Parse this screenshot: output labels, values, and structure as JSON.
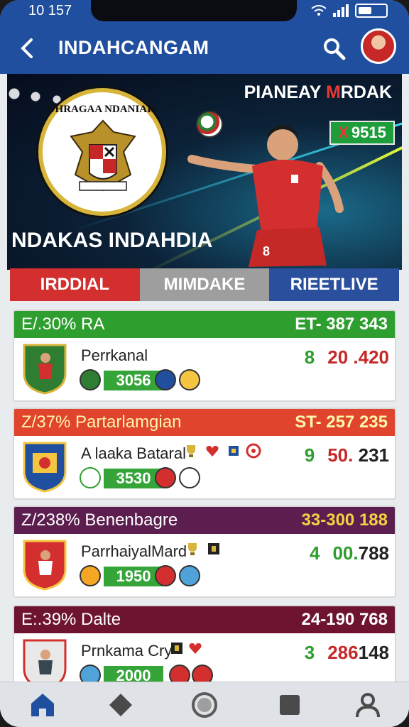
{
  "status_bar": {
    "time": "10 157"
  },
  "app_bar": {
    "title": "INDAHCANGAM"
  },
  "hero": {
    "headline_main": "PIANEAY ",
    "headline_accent": "M",
    "headline_tail": "RDAK",
    "crest_text": "UHRAGAA NDANIAIS",
    "score_badge_x": "X",
    "score_badge_value": "9515",
    "team_name": "NDAKAS INDAHDIA"
  },
  "tabs": [
    {
      "label": "IRDDIAL"
    },
    {
      "label": "MIMDAKE"
    },
    {
      "label": "RIEETLIVE"
    }
  ],
  "cards": [
    {
      "header_left": "E/.30% RA",
      "header_right": "ET- 387 343",
      "header_color": "#2e9e2e",
      "header_text_color": "#ffffff",
      "team": "Perrkanal",
      "pill": "3056",
      "score_green": "8",
      "score_red": "20",
      "score_dark": ".420"
    },
    {
      "header_left": "Z/37% Partarlamgian",
      "header_right": "ST- 257 235",
      "header_color": "#e0442c",
      "header_text_color": "#fff7a8",
      "team": "A laaka Bataral",
      "pill": "3530",
      "score_green": "9",
      "score_red": "50.",
      "score_dark": "231"
    },
    {
      "header_left": "Z/238% Benenbagre",
      "header_right": "33-300 188",
      "header_color": "#5b1e4e",
      "header_text_color": "#ffffff",
      "team": "ParrhaiyalMard",
      "pill": "1950",
      "score_green": "4",
      "score_red": "00.",
      "score_dark": "788"
    },
    {
      "header_left": "E:.39% Dalte",
      "header_right": "24-190 768",
      "header_color": "#6e1430",
      "header_text_color": "#ffffff",
      "team": "Prnkama Cry",
      "pill": "2000",
      "score_green": "3",
      "score_red": "286",
      "score_dark": "148"
    }
  ],
  "bottom_nav": [
    {
      "icon": "home-icon"
    },
    {
      "icon": "diamond-icon"
    },
    {
      "icon": "circle-icon"
    },
    {
      "icon": "square-icon"
    },
    {
      "icon": "profile-icon"
    }
  ],
  "colors": {
    "primary": "#1f4f9e",
    "red": "#d32f2f",
    "green": "#2e9e2e"
  }
}
